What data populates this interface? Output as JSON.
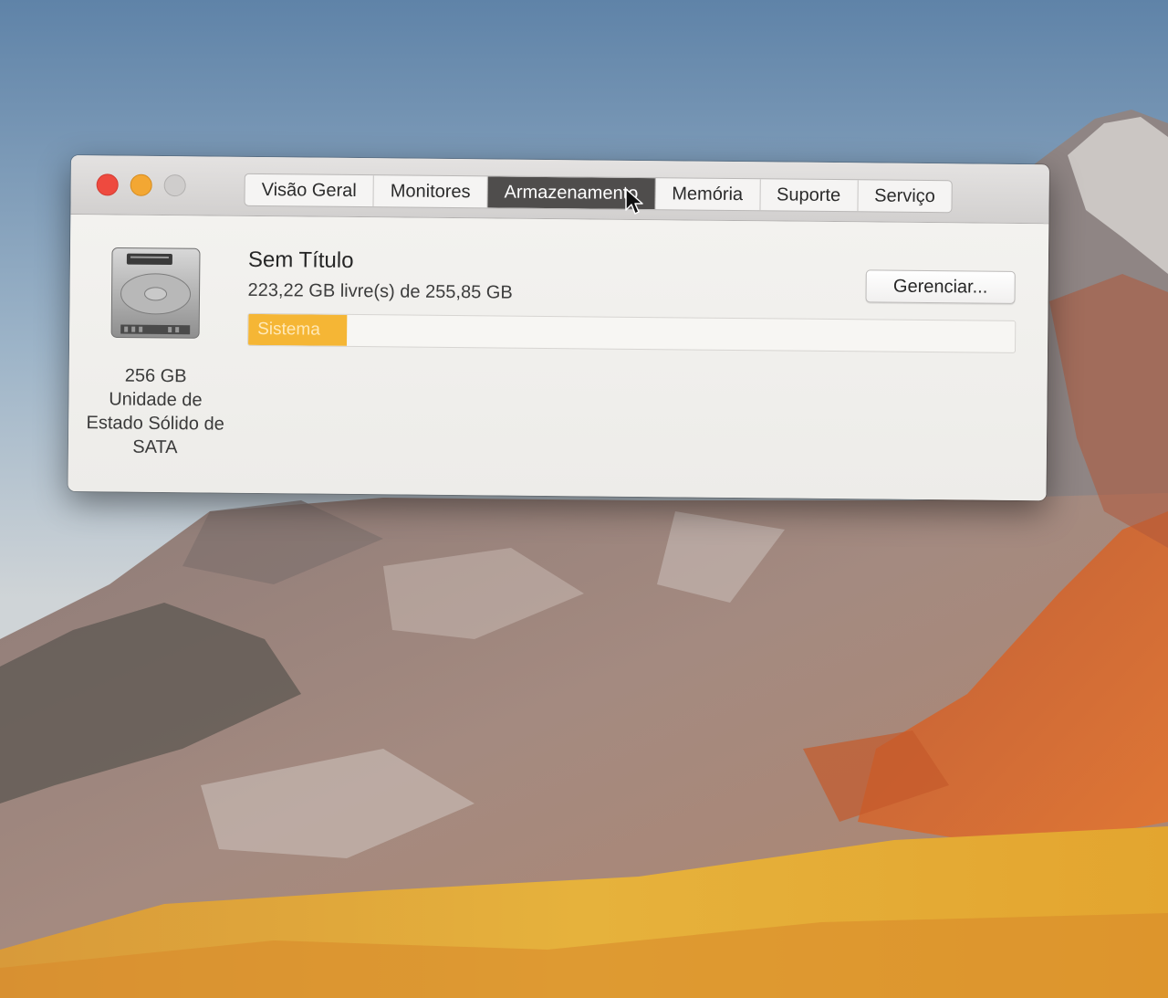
{
  "window": {
    "tabs": [
      {
        "label": "Visão Geral",
        "active": false
      },
      {
        "label": "Monitores",
        "active": false
      },
      {
        "label": "Armazenamento",
        "active": true
      },
      {
        "label": "Memória",
        "active": false
      },
      {
        "label": "Suporte",
        "active": false
      },
      {
        "label": "Serviço",
        "active": false
      }
    ]
  },
  "storage": {
    "drive_icon": "hard-drive-icon",
    "capacity_label": "256 GB",
    "type_line1": "Unidade de",
    "type_line2": "Estado Sólido de",
    "type_line3": "SATA",
    "volume_name": "Sem Título",
    "free_text": "223,22 GB livre(s) de 255,85 GB",
    "manage_button": "Gerenciar...",
    "bar": {
      "segment_label": "Sistema",
      "used_fraction": 0.128,
      "segment_color": "#f5b635"
    }
  },
  "colors": {
    "close": "#ee4a3f",
    "minimize": "#f3a733",
    "zoom": "#cfcdcc",
    "active_tab": "#4f4d4c"
  }
}
